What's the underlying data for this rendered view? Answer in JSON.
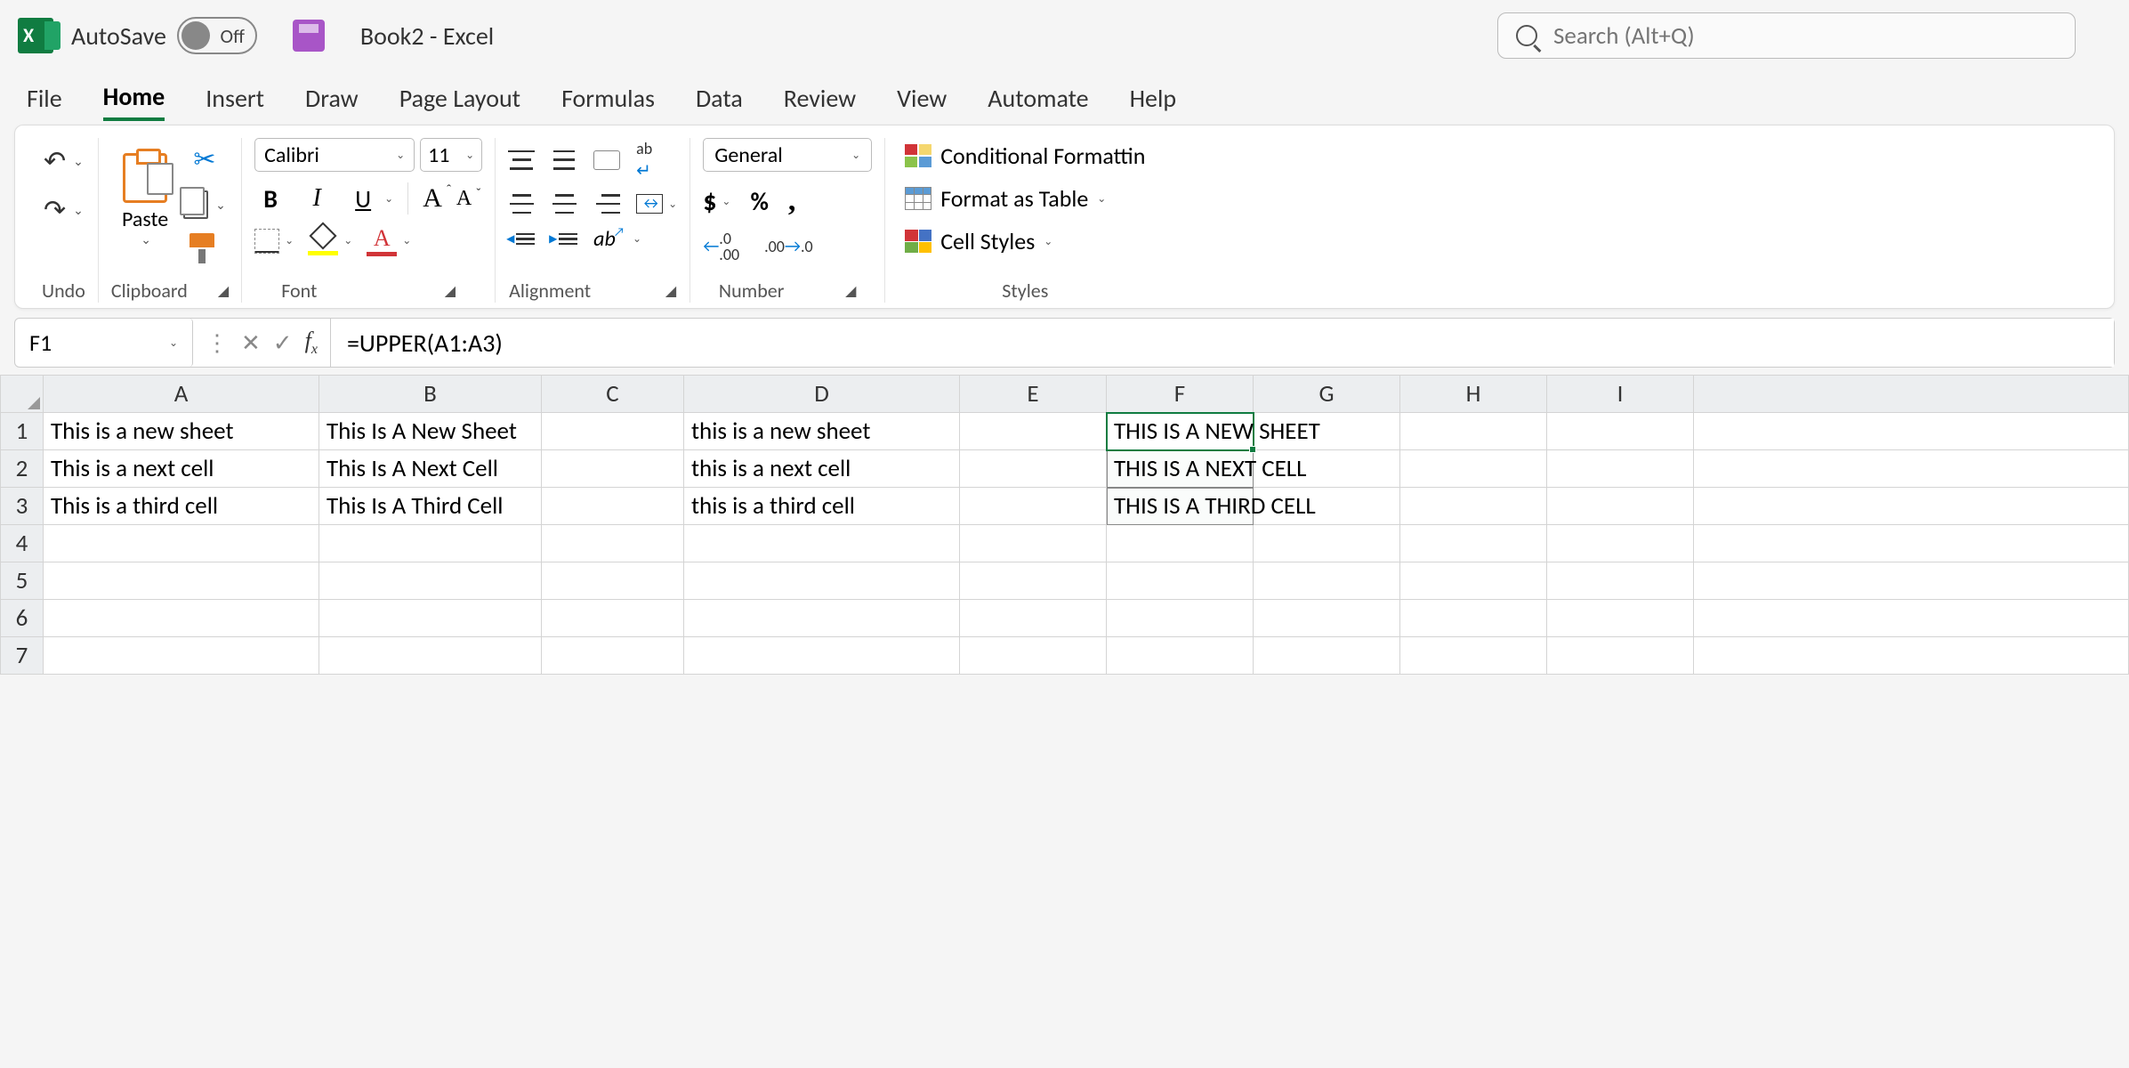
{
  "titlebar": {
    "autosave_label": "AutoSave",
    "autosave_state": "Off",
    "doc_title": "Book2  -  Excel",
    "search_placeholder": "Search (Alt+Q)"
  },
  "tabs": [
    "File",
    "Home",
    "Insert",
    "Draw",
    "Page Layout",
    "Formulas",
    "Data",
    "Review",
    "View",
    "Automate",
    "Help"
  ],
  "active_tab": "Home",
  "ribbon": {
    "undo_label": "Undo",
    "clipboard": {
      "paste": "Paste",
      "label": "Clipboard"
    },
    "font": {
      "name": "Calibri",
      "size": "11",
      "label": "Font"
    },
    "alignment_label": "Alignment",
    "number": {
      "format": "General",
      "label": "Number"
    },
    "styles": {
      "conditional": "Conditional Formattin",
      "table": "Format as Table",
      "cells": "Cell Styles",
      "label": "Styles"
    }
  },
  "formula_bar": {
    "name_box": "F1",
    "formula": "=UPPER(A1:A3)"
  },
  "columns": [
    "A",
    "B",
    "C",
    "D",
    "E",
    "F",
    "G",
    "H",
    "I"
  ],
  "rows": [
    {
      "n": "1",
      "A": "This is a new sheet",
      "B": "This Is A New Sheet",
      "D": "this is a new sheet",
      "F": "THIS IS A NEW SHEET"
    },
    {
      "n": "2",
      "A": "This is a next cell",
      "B": "This Is A Next Cell",
      "D": "this is a next cell",
      "F": "THIS IS A NEXT CELL"
    },
    {
      "n": "3",
      "A": "This is a third cell",
      "B": "This Is A Third Cell",
      "D": "this is a third cell",
      "F": "THIS IS A THIRD CELL"
    },
    {
      "n": "4"
    },
    {
      "n": "5"
    },
    {
      "n": "6"
    },
    {
      "n": "7"
    }
  ],
  "selection": {
    "active": "F1",
    "range": [
      "F1",
      "F2",
      "F3"
    ]
  }
}
